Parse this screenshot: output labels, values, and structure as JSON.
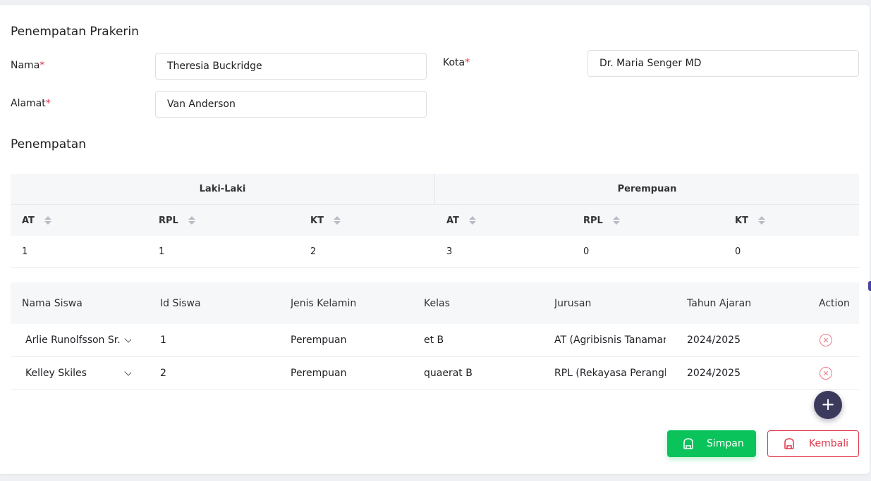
{
  "form": {
    "title": "Penempatan Prakerin",
    "required_mark": "*",
    "nama_label": "Nama",
    "nama_value": "Theresia Buckridge",
    "alamat_label": "Alamat",
    "alamat_value": "Van Anderson",
    "kota_label": "Kota",
    "kota_value": "Dr. Maria Senger MD"
  },
  "placement": {
    "title": "Penempatan",
    "group_male": "Laki-Laki",
    "group_female": "Perempuan",
    "columns": [
      "AT",
      "RPL",
      "KT",
      "AT",
      "RPL",
      "KT"
    ],
    "values": [
      "1",
      "1",
      "2",
      "3",
      "0",
      "0"
    ]
  },
  "students": {
    "headers": {
      "nama": "Nama Siswa",
      "id": "Id Siswa",
      "jenis": "Jenis Kelamin",
      "kelas": "Kelas",
      "jurusan": "Jurusan",
      "tahun": "Tahun Ajaran",
      "action": "Action"
    },
    "rows": [
      {
        "nama": "Arlie Runolfsson Sr.",
        "id": "1",
        "jenis": "Perempuan",
        "kelas": "et B",
        "jurusan": "AT (Agribisnis Tanaman)",
        "tahun": "2024/2025"
      },
      {
        "nama": "Kelley Skiles",
        "id": "2",
        "jenis": "Perempuan",
        "kelas": "quaerat B",
        "jurusan": "RPL (Rekayasa Perangkat Lunak)",
        "tahun": "2024/2025"
      }
    ]
  },
  "actions": {
    "add_icon": "plus-icon",
    "save_label": "Simpan",
    "back_label": "Kembali",
    "save_color": "#0ac35a",
    "back_color": "#e0364a",
    "fab_color": "#3c3a5c"
  }
}
